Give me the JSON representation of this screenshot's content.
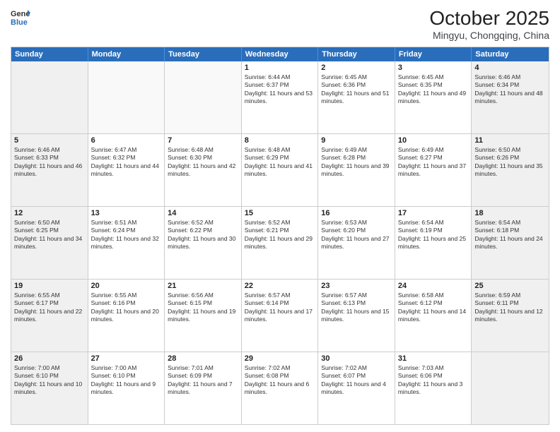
{
  "logo": {
    "general": "General",
    "blue": "Blue"
  },
  "title": "October 2025",
  "location": "Mingyu, Chongqing, China",
  "days_of_week": [
    "Sunday",
    "Monday",
    "Tuesday",
    "Wednesday",
    "Thursday",
    "Friday",
    "Saturday"
  ],
  "rows": [
    [
      {
        "day": "",
        "text": ""
      },
      {
        "day": "",
        "text": ""
      },
      {
        "day": "",
        "text": ""
      },
      {
        "day": "1",
        "text": "Sunrise: 6:44 AM\nSunset: 6:37 PM\nDaylight: 11 hours and 53 minutes."
      },
      {
        "day": "2",
        "text": "Sunrise: 6:45 AM\nSunset: 6:36 PM\nDaylight: 11 hours and 51 minutes."
      },
      {
        "day": "3",
        "text": "Sunrise: 6:45 AM\nSunset: 6:35 PM\nDaylight: 11 hours and 49 minutes."
      },
      {
        "day": "4",
        "text": "Sunrise: 6:46 AM\nSunset: 6:34 PM\nDaylight: 11 hours and 48 minutes."
      }
    ],
    [
      {
        "day": "5",
        "text": "Sunrise: 6:46 AM\nSunset: 6:33 PM\nDaylight: 11 hours and 46 minutes."
      },
      {
        "day": "6",
        "text": "Sunrise: 6:47 AM\nSunset: 6:32 PM\nDaylight: 11 hours and 44 minutes."
      },
      {
        "day": "7",
        "text": "Sunrise: 6:48 AM\nSunset: 6:30 PM\nDaylight: 11 hours and 42 minutes."
      },
      {
        "day": "8",
        "text": "Sunrise: 6:48 AM\nSunset: 6:29 PM\nDaylight: 11 hours and 41 minutes."
      },
      {
        "day": "9",
        "text": "Sunrise: 6:49 AM\nSunset: 6:28 PM\nDaylight: 11 hours and 39 minutes."
      },
      {
        "day": "10",
        "text": "Sunrise: 6:49 AM\nSunset: 6:27 PM\nDaylight: 11 hours and 37 minutes."
      },
      {
        "day": "11",
        "text": "Sunrise: 6:50 AM\nSunset: 6:26 PM\nDaylight: 11 hours and 35 minutes."
      }
    ],
    [
      {
        "day": "12",
        "text": "Sunrise: 6:50 AM\nSunset: 6:25 PM\nDaylight: 11 hours and 34 minutes."
      },
      {
        "day": "13",
        "text": "Sunrise: 6:51 AM\nSunset: 6:24 PM\nDaylight: 11 hours and 32 minutes."
      },
      {
        "day": "14",
        "text": "Sunrise: 6:52 AM\nSunset: 6:22 PM\nDaylight: 11 hours and 30 minutes."
      },
      {
        "day": "15",
        "text": "Sunrise: 6:52 AM\nSunset: 6:21 PM\nDaylight: 11 hours and 29 minutes."
      },
      {
        "day": "16",
        "text": "Sunrise: 6:53 AM\nSunset: 6:20 PM\nDaylight: 11 hours and 27 minutes."
      },
      {
        "day": "17",
        "text": "Sunrise: 6:54 AM\nSunset: 6:19 PM\nDaylight: 11 hours and 25 minutes."
      },
      {
        "day": "18",
        "text": "Sunrise: 6:54 AM\nSunset: 6:18 PM\nDaylight: 11 hours and 24 minutes."
      }
    ],
    [
      {
        "day": "19",
        "text": "Sunrise: 6:55 AM\nSunset: 6:17 PM\nDaylight: 11 hours and 22 minutes."
      },
      {
        "day": "20",
        "text": "Sunrise: 6:55 AM\nSunset: 6:16 PM\nDaylight: 11 hours and 20 minutes."
      },
      {
        "day": "21",
        "text": "Sunrise: 6:56 AM\nSunset: 6:15 PM\nDaylight: 11 hours and 19 minutes."
      },
      {
        "day": "22",
        "text": "Sunrise: 6:57 AM\nSunset: 6:14 PM\nDaylight: 11 hours and 17 minutes."
      },
      {
        "day": "23",
        "text": "Sunrise: 6:57 AM\nSunset: 6:13 PM\nDaylight: 11 hours and 15 minutes."
      },
      {
        "day": "24",
        "text": "Sunrise: 6:58 AM\nSunset: 6:12 PM\nDaylight: 11 hours and 14 minutes."
      },
      {
        "day": "25",
        "text": "Sunrise: 6:59 AM\nSunset: 6:11 PM\nDaylight: 11 hours and 12 minutes."
      }
    ],
    [
      {
        "day": "26",
        "text": "Sunrise: 7:00 AM\nSunset: 6:10 PM\nDaylight: 11 hours and 10 minutes."
      },
      {
        "day": "27",
        "text": "Sunrise: 7:00 AM\nSunset: 6:10 PM\nDaylight: 11 hours and 9 minutes."
      },
      {
        "day": "28",
        "text": "Sunrise: 7:01 AM\nSunset: 6:09 PM\nDaylight: 11 hours and 7 minutes."
      },
      {
        "day": "29",
        "text": "Sunrise: 7:02 AM\nSunset: 6:08 PM\nDaylight: 11 hours and 6 minutes."
      },
      {
        "day": "30",
        "text": "Sunrise: 7:02 AM\nSunset: 6:07 PM\nDaylight: 11 hours and 4 minutes."
      },
      {
        "day": "31",
        "text": "Sunrise: 7:03 AM\nSunset: 6:06 PM\nDaylight: 11 hours and 3 minutes."
      },
      {
        "day": "",
        "text": ""
      }
    ]
  ]
}
